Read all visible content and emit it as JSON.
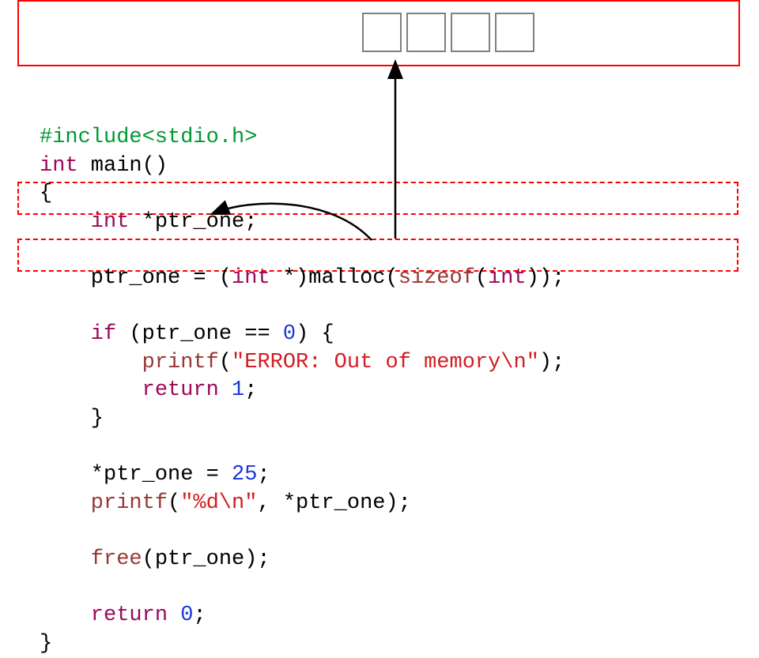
{
  "boxes": {
    "heap_cells": 4
  },
  "code": {
    "l01a": "#include<stdio.h>",
    "l02a": "int",
    "l02b": " main() ",
    "l03a": "{ ",
    "l04a": "    int",
    "l04b": " *ptr_one; ",
    "l05a": "",
    "l06a": "    ptr_one = (",
    "l06b": "int",
    "l06c": " *)malloc(",
    "l06d": "sizeof",
    "l06e": "(",
    "l06f": "int",
    "l06g": ")); ",
    "l07a": "",
    "l08a": "    if",
    "l08b": " (ptr_one == ",
    "l08c": "0",
    "l08d": ") { ",
    "l09a": "        printf",
    "l09b": "(",
    "l09c": "\"ERROR: Out of memory\\n\"",
    "l09d": "); ",
    "l10a": "        return ",
    "l10b": "1",
    "l10c": "; ",
    "l11a": "    } ",
    "l12a": "",
    "l13a": "    *ptr_one = ",
    "l13b": "25",
    "l13c": "; ",
    "l14a": "    printf",
    "l14b": "(",
    "l14c": "\"%d\\n\"",
    "l14d": ", *ptr_one); ",
    "l15a": "",
    "l16a": "    free",
    "l16b": "(ptr_one); ",
    "l17a": "",
    "l18a": "    return ",
    "l18b": "0",
    "l18c": "; ",
    "l19a": "} "
  },
  "colors": {
    "keyword": "#9b0959",
    "preproc": "#009933",
    "func": "#963835",
    "string": "#d21d23",
    "number": "#1636d9",
    "border_red": "#ff0000",
    "border_grey": "#808080"
  },
  "chart_data": {
    "type": "diagram",
    "description": "C malloc example with a 4-byte heap allocation. A red box at top represents heap memory with four one-byte cells; an arrow from the stack variable ptr_one points to that block. Two red dashed boxes highlight the declaration line and the malloc-assignment line; a curved arrow shows the result of malloc being stored into ptr_one.",
    "heap_cells": 4,
    "pointer_var": "ptr_one",
    "alloc_bytes": "sizeof(int)",
    "assigned_value": 25
  }
}
